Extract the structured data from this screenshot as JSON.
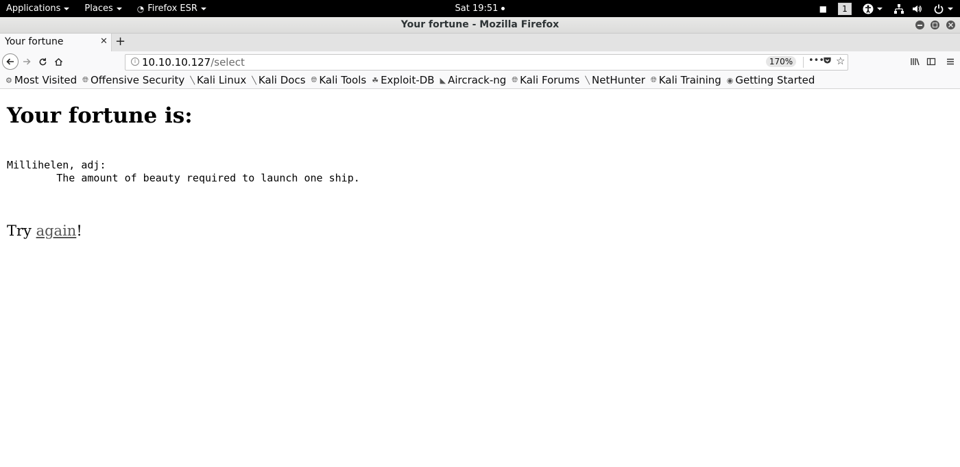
{
  "topbar": {
    "applications": "Applications",
    "places": "Places",
    "firefox_menu": "Firefox ESR",
    "clock": "Sat 19:51",
    "workspace": "1"
  },
  "window": {
    "title": "Your fortune - Mozilla Firefox"
  },
  "tabs": [
    {
      "label": "Your fortune"
    }
  ],
  "navbar": {
    "url_host": "10.10.10.127",
    "url_path": "/select",
    "zoom": "170%"
  },
  "bookmarks": [
    {
      "label": "Most Visited",
      "icon": "gear-icon"
    },
    {
      "label": "Offensive Security",
      "icon": "globe-icon"
    },
    {
      "label": "Kali Linux",
      "icon": "kali-icon"
    },
    {
      "label": "Kali Docs",
      "icon": "kali-icon"
    },
    {
      "label": "Kali Tools",
      "icon": "globe-icon"
    },
    {
      "label": "Exploit-DB",
      "icon": "exploitdb-icon"
    },
    {
      "label": "Aircrack-ng",
      "icon": "aircrack-icon"
    },
    {
      "label": "Kali Forums",
      "icon": "globe-icon"
    },
    {
      "label": "NetHunter",
      "icon": "kali-icon"
    },
    {
      "label": "Kali Training",
      "icon": "globe-icon"
    },
    {
      "label": "Getting Started",
      "icon": "firefox-icon"
    }
  ],
  "page": {
    "heading": "Your fortune is:",
    "fortune_line1": "Millihelen, adj:",
    "fortune_line2": "        The amount of beauty required to launch one ship.",
    "try_prefix": "Try ",
    "try_link": "again",
    "try_suffix": "!"
  }
}
